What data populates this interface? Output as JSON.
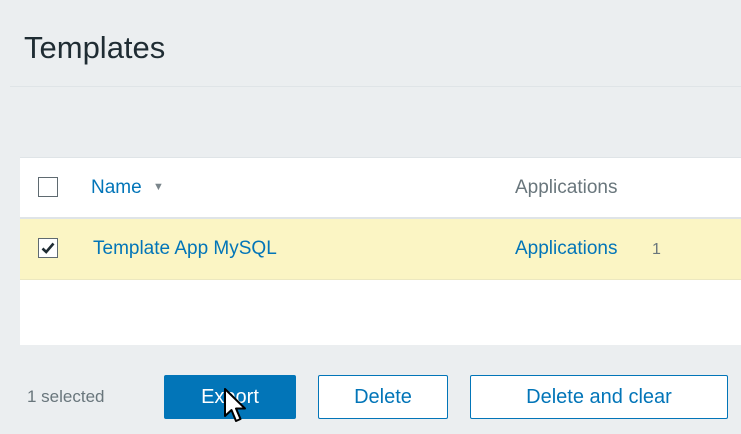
{
  "header": {
    "title": "Templates"
  },
  "table": {
    "columns": {
      "name": "Name",
      "applications": "Applications"
    },
    "sort": {
      "column": "Name",
      "direction": "descending-arrow"
    },
    "rows": [
      {
        "checked": true,
        "name": "Template App MySQL",
        "applications_label": "Applications",
        "applications_count": "1"
      }
    ]
  },
  "footer": {
    "selected_text": "1 selected",
    "export_label": "Export",
    "delete_label": "Delete",
    "delete_clear_label": "Delete and clear"
  },
  "colors": {
    "link": "#0275b8",
    "selected_row": "#fbf5c4",
    "primary_button": "#0275b8",
    "background": "#ebeef0"
  },
  "icons": {
    "sort": "sort-down-arrow-icon",
    "check": "checkmark-icon",
    "cursor": "mouse-pointer-icon"
  }
}
